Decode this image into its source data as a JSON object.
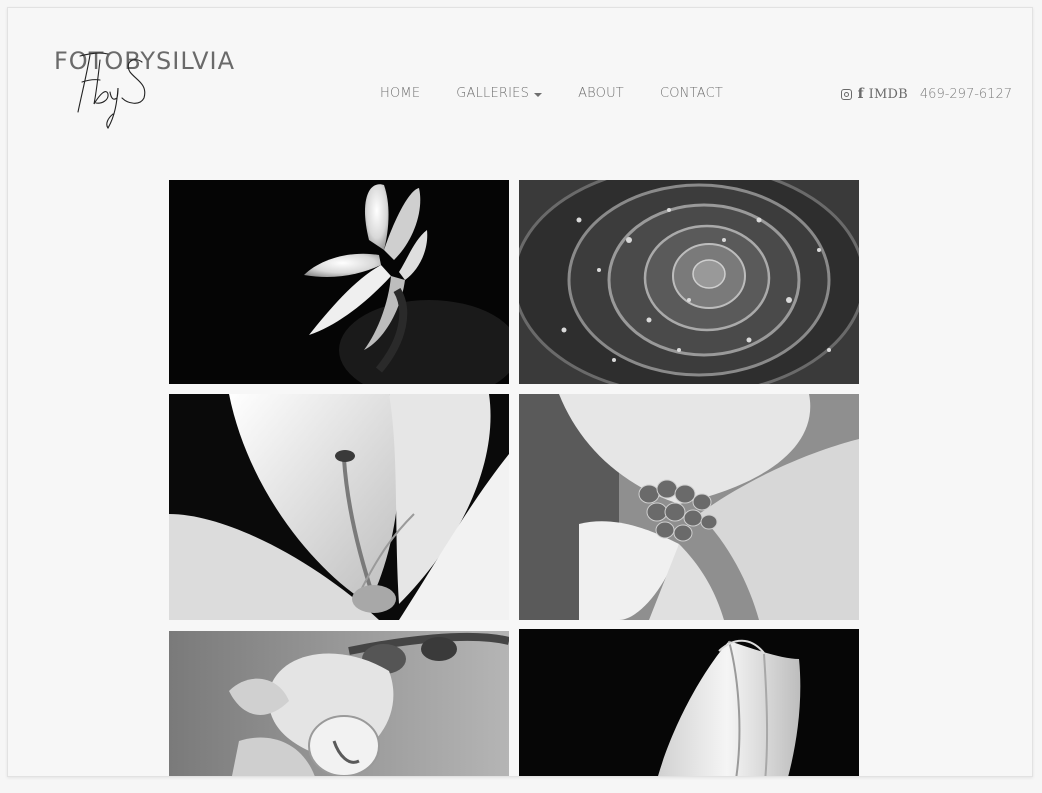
{
  "brand": {
    "name": "FOTOBYSILVIA",
    "logo_text": "FbyS"
  },
  "nav": {
    "items": [
      {
        "label": "HOME"
      },
      {
        "label": "GALLERIES",
        "has_dropdown": true
      },
      {
        "label": "ABOUT"
      },
      {
        "label": "CONTACT"
      }
    ]
  },
  "social": {
    "instagram_icon": "instagram-icon",
    "facebook_icon": "facebook-icon",
    "imdb_label": "IMDB",
    "phone": "469-297-6127"
  },
  "gallery": {
    "photos": [
      {
        "subject": "white lily on black background"
      },
      {
        "subject": "succulent rosette with water droplets"
      },
      {
        "subject": "lily close-up with stamen"
      },
      {
        "subject": "dogwood flower center"
      },
      {
        "subject": "orchid bloom"
      },
      {
        "subject": "tulip on black background"
      }
    ]
  },
  "colors": {
    "page_background": "#f7f7f7",
    "text": "#6f6f6f"
  }
}
